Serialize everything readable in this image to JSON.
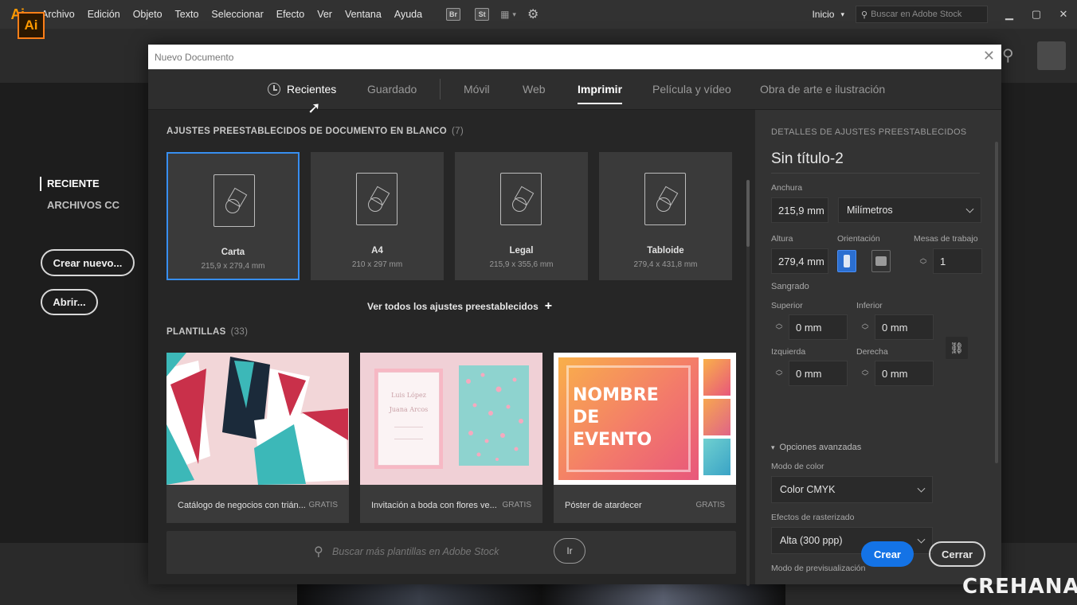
{
  "menubar": {
    "app_logo": "Ai",
    "items": [
      "Archivo",
      "Edición",
      "Objeto",
      "Texto",
      "Seleccionar",
      "Efecto",
      "Ver",
      "Ventana",
      "Ayuda"
    ],
    "bridge_label": "Br",
    "stock_label": "St",
    "workspace": "Inicio",
    "stock_search_placeholder": "Buscar en Adobe Stock"
  },
  "start": {
    "logo": "Ai",
    "nav": [
      "RECIENTE",
      "ARCHIVOS CC"
    ],
    "create_button": "Crear nuevo...",
    "open_button": "Abrir..."
  },
  "dialog": {
    "title": "Nuevo Documento",
    "tabs": [
      "Recientes",
      "Guardado",
      "Móvil",
      "Web",
      "Imprimir",
      "Película y vídeo",
      "Obra de arte e ilustración"
    ],
    "active_tab": "Imprimir",
    "blank_presets": {
      "heading": "AJUSTES PREESTABLECIDOS DE DOCUMENTO EN BLANCO",
      "count": "(7)",
      "items": [
        {
          "name": "Carta",
          "size": "215,9 x 279,4 mm",
          "selected": true
        },
        {
          "name": "A4",
          "size": "210 x 297 mm",
          "selected": false
        },
        {
          "name": "Legal",
          "size": "215,9 x 355,6 mm",
          "selected": false
        },
        {
          "name": "Tabloide",
          "size": "279,4 x 431,8 mm",
          "selected": false
        }
      ],
      "see_all": "Ver todos los ajustes preestablecidos"
    },
    "templates": {
      "heading": "PLANTILLAS",
      "count": "(33)",
      "items": [
        {
          "name": "Catálogo de negocios con trián...",
          "badge": "GRATIS"
        },
        {
          "name": "Invitación a boda con flores ve...",
          "badge": "GRATIS"
        },
        {
          "name": "Póster de atardecer",
          "badge": "GRATIS"
        }
      ],
      "thumb_texts": {
        "wedding_line1": "Luis López",
        "wedding_line2": "Juana Arcos",
        "poster_title": "NOMBRE DE EVENTO"
      },
      "stock_search_placeholder": "Buscar más plantillas en Adobe Stock",
      "go_button": "Ir"
    },
    "details": {
      "heading": "DETALLES DE AJUSTES PREESTABLECIDOS",
      "doc_name": "Sin título-2",
      "width_label": "Anchura",
      "width_value": "215,9 mm",
      "units": "Milímetros",
      "height_label": "Altura",
      "height_value": "279,4 mm",
      "orientation_label": "Orientación",
      "artboards_label": "Mesas de trabajo",
      "artboards_value": "1",
      "bleed_label": "Sangrado",
      "top_label": "Superior",
      "top_value": "0 mm",
      "bottom_label": "Inferior",
      "bottom_value": "0 mm",
      "left_label": "Izquierda",
      "left_value": "0 mm",
      "right_label": "Derecha",
      "right_value": "0 mm",
      "advanced": "Opciones avanzadas",
      "color_mode_label": "Modo de color",
      "color_mode_value": "Color CMYK",
      "raster_label": "Efectos de rasterizado",
      "raster_value": "Alta (300 ppp)",
      "preview_label": "Modo de previsualización"
    },
    "create_button": "Crear",
    "close_button": "Cerrar"
  },
  "watermark": "CREHANA",
  "colors": {
    "accent": "#1473e6",
    "selection": "#378ef0",
    "ai_orange": "#ff9a00"
  }
}
